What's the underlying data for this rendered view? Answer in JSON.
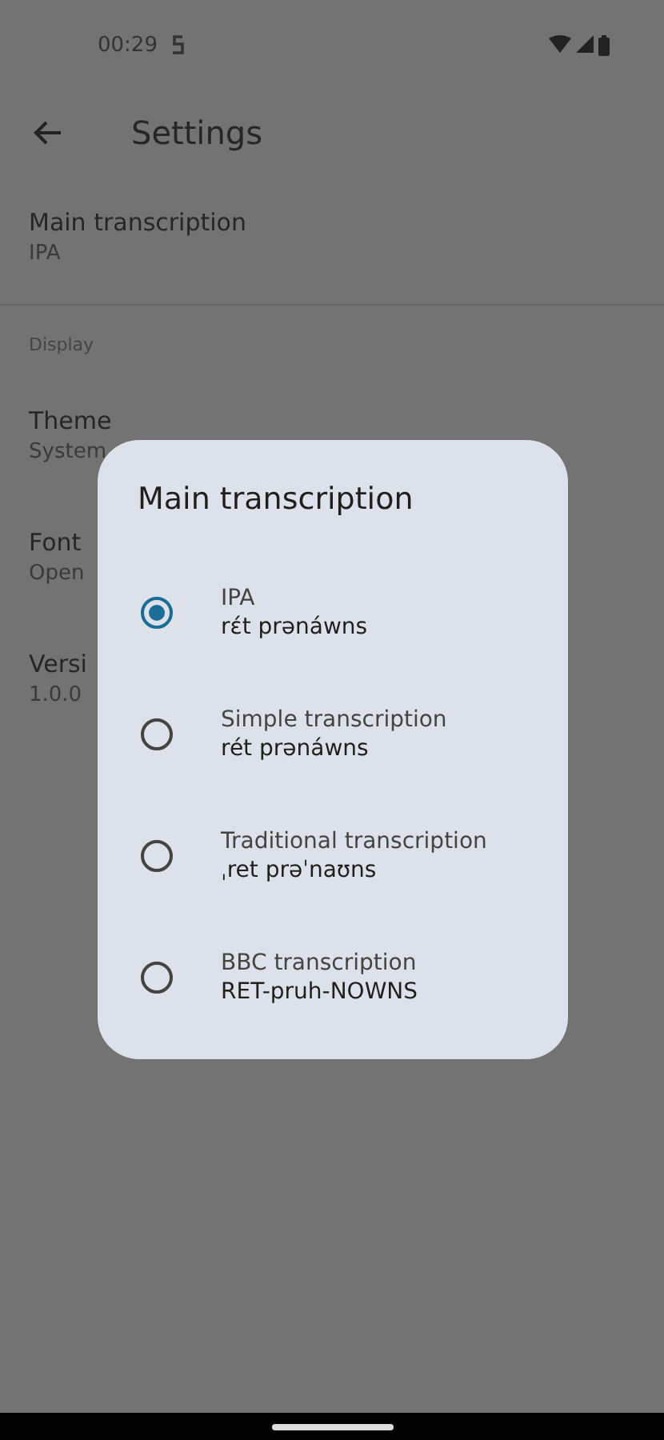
{
  "status_bar": {
    "time": "00:29"
  },
  "app_bar": {
    "title": "Settings"
  },
  "settings": [
    {
      "kind": "item",
      "title": "Main transcription",
      "value": "IPA"
    },
    {
      "kind": "divider"
    },
    {
      "kind": "header",
      "title": "Display"
    },
    {
      "kind": "item",
      "title": "Theme",
      "value": "System"
    },
    {
      "kind": "item",
      "title": "Font",
      "value": "Open"
    },
    {
      "kind": "item",
      "title": "Versi",
      "value": "1.0.0"
    }
  ],
  "dialog": {
    "title": "Main transcription",
    "options": [
      {
        "label": "IPA",
        "example": "rɛ́t prənáwns",
        "selected": true
      },
      {
        "label": "Simple transcription",
        "example": "rét prənáwns",
        "selected": false
      },
      {
        "label": "Traditional transcription",
        "example": "ˌret prəˈnaʊns",
        "selected": false
      },
      {
        "label": "BBC transcription",
        "example": "RET-pruh-NOWNS",
        "selected": false
      }
    ]
  }
}
